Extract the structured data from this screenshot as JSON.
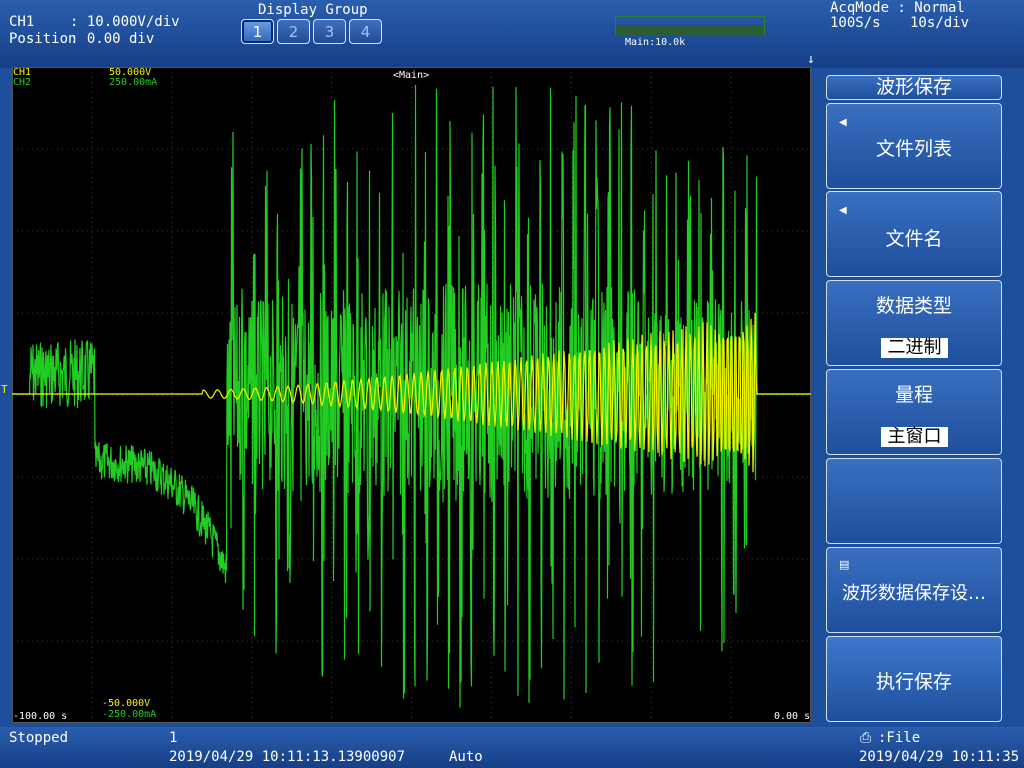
{
  "header": {
    "ch_label": "CH1",
    "volts_per_div": ": 10.000V/div",
    "position_label": "Position",
    "position_value": ": 0.00 div",
    "display_group_title": "Display Group",
    "display_groups": [
      "1",
      "2",
      "3",
      "4"
    ],
    "active_group": "1",
    "zoom_label": "Main:10.0k",
    "acq_mode": "AcqMode : Normal",
    "sample_rate": "100S/s",
    "time_per_div": "10s/div"
  },
  "scope": {
    "ch1_name": "CH1",
    "ch2_name": "CH2",
    "ch1_top": "50.000V",
    "ch2_top": "250.00mA",
    "ch1_bottom": "-50.000V",
    "ch2_bottom": "-250.00mA",
    "window_label": "<Main>",
    "x_start": "-100.00 s",
    "x_end": "0.00 s",
    "trigger_marker": "T",
    "colors": {
      "ch1": "#f5f500",
      "ch2": "#22cc22",
      "background": "#000000",
      "grid": "#3a3a3a"
    }
  },
  "menu": {
    "title": "波形保存",
    "file_list": "文件列表",
    "file_name": "文件名",
    "data_type_label": "数据类型",
    "data_type_value": "二进制",
    "range_label": "量程",
    "range_value": "主窗口",
    "save_settings": "波形数据保存设…",
    "execute_save": "执行保存"
  },
  "status": {
    "state": "Stopped",
    "record_count": "1",
    "trigger_time": "2019/04/29 10:11:13.13900907",
    "trigger_mode": "Auto",
    "save_target": ":File",
    "clock": "2019/04/29 10:11:35"
  }
}
